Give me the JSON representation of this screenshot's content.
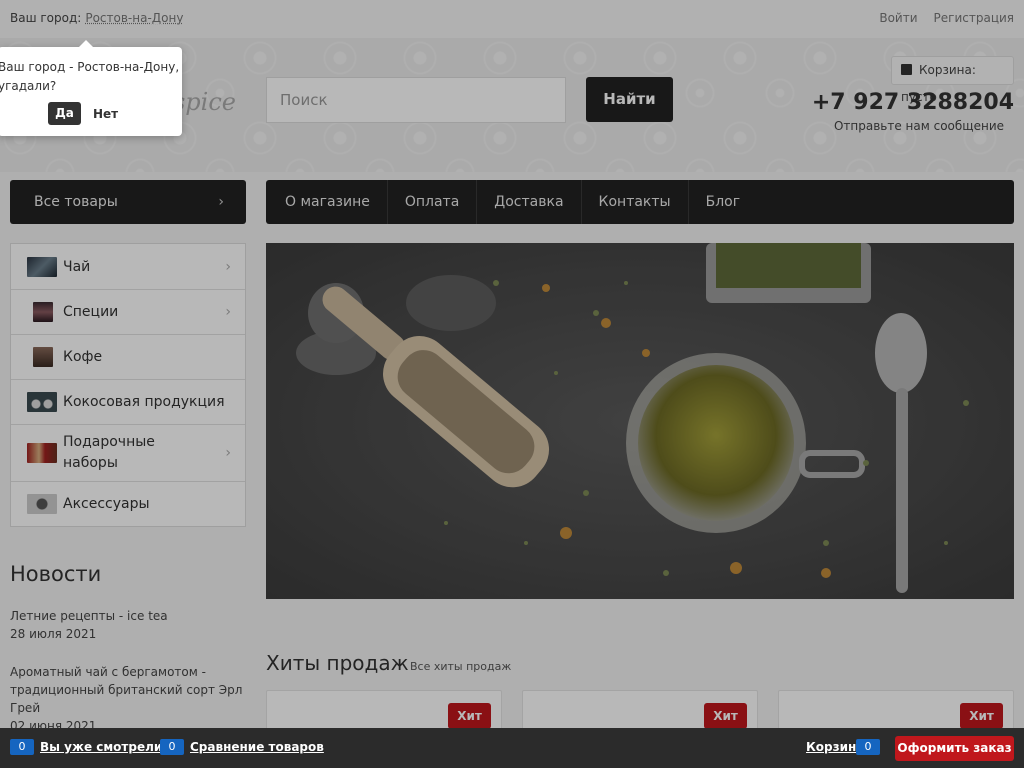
{
  "topbar": {
    "city_label": "Ваш город:",
    "city_name": "Ростов-на-Дону",
    "login": "Войти",
    "register": "Регистрация"
  },
  "header": {
    "logo_text": "d spice",
    "search_placeholder": "Поиск",
    "search_button": "Найти",
    "cart_label": "Корзина: пусто",
    "phone": "+7 927 3288204",
    "send_message": "Отправьте нам сообщение"
  },
  "catalog": {
    "all_products": "Все товары",
    "items": [
      {
        "label": "Чай"
      },
      {
        "label": "Специи"
      },
      {
        "label": "Кофе"
      },
      {
        "label": "Кокосовая продукция"
      },
      {
        "label": "Подарочные наборы"
      },
      {
        "label": "Аксессуары"
      }
    ]
  },
  "nav": {
    "items": [
      "О магазине",
      "Оплата",
      "Доставка",
      "Контакты",
      "Блог"
    ]
  },
  "news": {
    "title": "Новости",
    "items": [
      {
        "title": "Летние рецепты - ice tea",
        "date": "28 июля 2021"
      },
      {
        "title": "Ароматный чай с бергамотом - традиционный британский сорт Эрл Грей",
        "date": "02 июня 2021"
      }
    ]
  },
  "hits": {
    "title": "Хиты продаж",
    "all_link": "Все хиты продаж",
    "badge": "Хит"
  },
  "city_popup": {
    "question": "Ваш город - Ростов-на-Дону, угадали?",
    "yes": "Да",
    "no": "Нет"
  },
  "bottom_bar": {
    "viewed_count": "0",
    "viewed_label": "Вы уже смотрели",
    "compare_count": "0",
    "compare_label": "Сравнение товаров",
    "cart_label": "Корзина",
    "cart_count": "0",
    "checkout": "Оформить заказ"
  },
  "colors": {
    "accent_red": "#c0171c",
    "count_blue": "#1565c0",
    "dark": "#222222"
  }
}
